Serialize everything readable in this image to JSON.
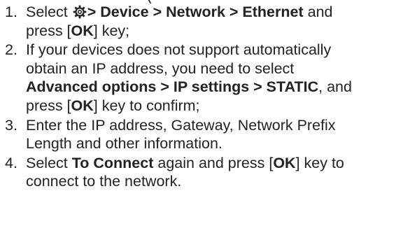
{
  "steps": [
    {
      "num": "1.",
      "icon": "gear-icon",
      "l1_pre": "Select ",
      "l1_bold": "> Device > Network > Ethernet",
      "l1_post": " and",
      "l2_pre": "press [",
      "l2_bold": "OK",
      "l2_post": "] key;"
    },
    {
      "num": "2.",
      "l1": "If your devices does not support automatically",
      "l2": "obtain an IP address, you need to select",
      "l3_bold": "Advanced options > IP settings > STATIC",
      "l3_post": ", and",
      "l4_pre": "press [",
      "l4_bold": "OK",
      "l4_post": "] key to confirm;"
    },
    {
      "num": "3.",
      "l1": "Enter the IP address, Gateway, Network Prefix",
      "l2": "Length and other information."
    },
    {
      "num": "4.",
      "l1_pre": "Select ",
      "l1_bold": "To Connect",
      "l1_mid": " again and press [",
      "l1_bold2": "OK",
      "l1_post": "] key to",
      "l2": "connect to the network."
    }
  ]
}
